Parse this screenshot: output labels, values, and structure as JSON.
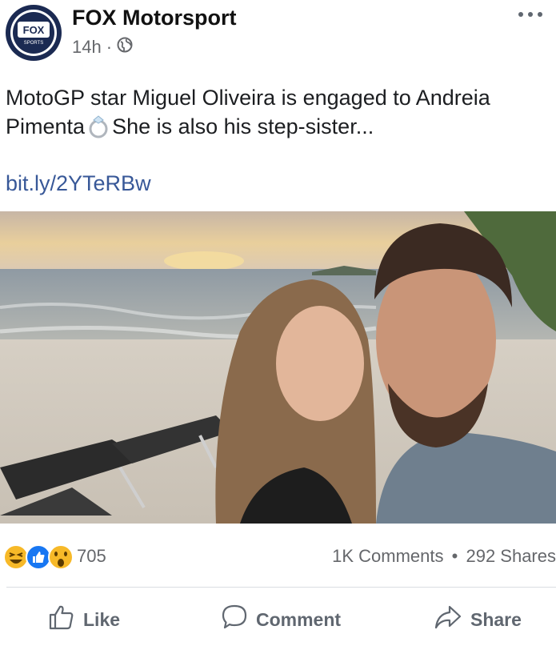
{
  "post": {
    "page_name": "FOX Motorsport",
    "time": "14h",
    "separator": "·",
    "text_line1": "MotoGP star Miguel Oliveira is engaged to Andreia",
    "text_line2_a": "Pimenta",
    "text_line2_b": " She is also his step-sister...",
    "link": "bit.ly/2YTeRBw",
    "avatar_logo": "FOX",
    "avatar_sub": "SPORTS"
  },
  "engagement": {
    "reaction_count": "705",
    "comments": "1K Comments",
    "dot": "•",
    "shares": "292 Shares"
  },
  "actions": {
    "like": "Like",
    "comment": "Comment",
    "share": "Share"
  },
  "icons": {
    "globe": "globe-icon",
    "more": "more-dots-icon",
    "ring": "ring-emoji-icon",
    "haha": "haha-reaction-icon",
    "like": "like-reaction-icon",
    "wow": "wow-reaction-icon",
    "thumb": "thumbs-up-icon",
    "bubble": "comment-bubble-icon",
    "arrow": "share-arrow-icon"
  },
  "colors": {
    "link": "#385898",
    "muted": "#65676b",
    "action": "#606770",
    "brand_navy": "#1b2a52",
    "like_blue": "#1877f2",
    "reaction_yellow": "#f7b928"
  }
}
